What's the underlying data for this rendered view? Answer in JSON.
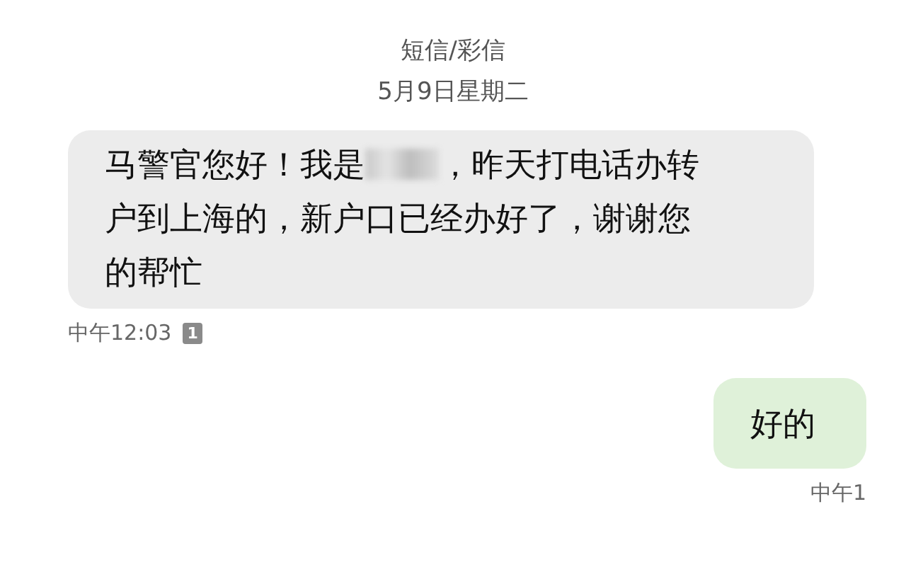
{
  "header": {
    "title": "短信/彩信",
    "date": "5月9日星期二"
  },
  "messages": [
    {
      "kind": "incoming",
      "text_before": "马警官您好！我是",
      "redacted": true,
      "text_after": "，昨天打电话办转",
      "continuation": "户到上海的，新户口已经办好了，谢谢您的帮忙",
      "time": "中午12:03",
      "sim": "1"
    },
    {
      "kind": "outgoing",
      "text_before": "好的",
      "time": "中午1"
    }
  ]
}
